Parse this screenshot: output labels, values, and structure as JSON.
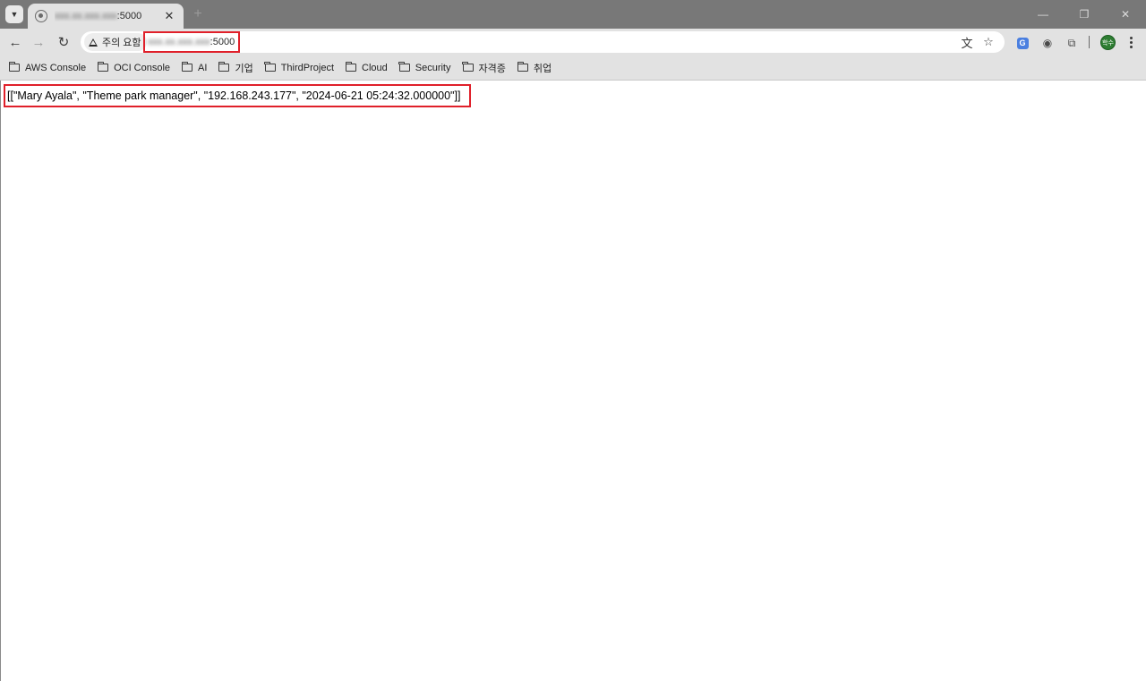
{
  "browser": {
    "tab": {
      "title_blurred": "xxx.xx.xxx.xxx",
      "title_port": ":5000",
      "close_glyph": "✕"
    },
    "new_tab_glyph": "+",
    "window_controls": {
      "minimize": "—",
      "restore": "❐",
      "close": "✕"
    },
    "nav": {
      "back": "←",
      "forward": "→",
      "reload": "↻"
    },
    "security_chip_label": "주의 요함",
    "address": {
      "host_blurred": "xxx.xx.xxx.xxx",
      "port": ":5000"
    },
    "omnibox_icons": {
      "translate": "文",
      "bookmark_star": "☆"
    },
    "toolbar_icons": {
      "google_translate_ext": "G",
      "camera": "◉",
      "extensions": "⧉"
    },
    "profile_avatar_text": "학수"
  },
  "bookmarks": [
    {
      "label": "AWS Console"
    },
    {
      "label": "OCI Console"
    },
    {
      "label": "AI"
    },
    {
      "label": "기업"
    },
    {
      "label": "ThirdProject"
    },
    {
      "label": "Cloud"
    },
    {
      "label": "Security"
    },
    {
      "label": "자격증"
    },
    {
      "label": "취업"
    }
  ],
  "page": {
    "response_text": "[[\"Mary Ayala\", \"Theme park manager\", \"192.168.243.177\", \"2024-06-21 05:24:32.000000\"]]"
  },
  "colors": {
    "highlight_border": "#e0202a",
    "tabstrip": "#787878",
    "toolbar": "#e2e2e2"
  }
}
